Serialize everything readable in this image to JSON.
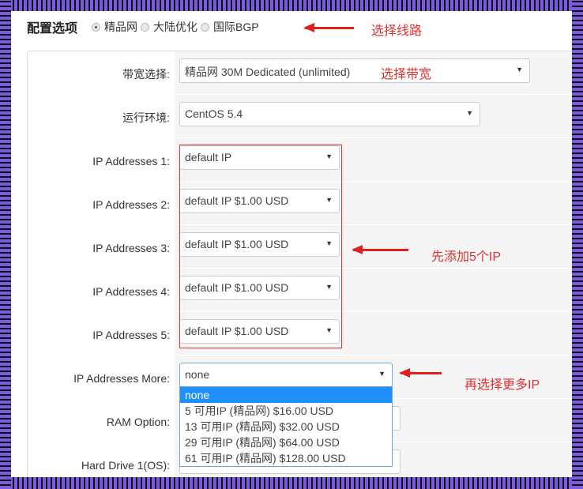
{
  "header": {
    "title": "配置选项",
    "line_options": [
      {
        "label": "精品网",
        "selected": true
      },
      {
        "label": "大陆优化",
        "selected": false
      },
      {
        "label": "国际BGP",
        "selected": false
      }
    ]
  },
  "annotations": {
    "choose_line": "选择线路",
    "choose_bandwidth": "选择带宽",
    "add_ips": "先添加5个IP",
    "more_ips": "再选择更多IP",
    "color": "#e03030"
  },
  "form": {
    "rows": [
      {
        "label": "带宽选择:",
        "value": "精品网 30M Dedicated (unlimited)"
      },
      {
        "label": "运行环境:",
        "value": "CentOS 5.4"
      },
      {
        "label": "IP Addresses 1:",
        "value": "default IP"
      },
      {
        "label": "IP Addresses 2:",
        "value": "default IP $1.00 USD"
      },
      {
        "label": "IP Addresses 3:",
        "value": "default IP $1.00 USD"
      },
      {
        "label": "IP Addresses 4:",
        "value": "default IP $1.00 USD"
      },
      {
        "label": "IP Addresses 5:",
        "value": "default IP $1.00 USD"
      },
      {
        "label": "IP Addresses More:",
        "value": "none"
      },
      {
        "label": "RAM Option:",
        "value": ""
      },
      {
        "label": "Hard Drive 1(OS):",
        "value": ""
      }
    ],
    "more_options": [
      "none",
      "5 可用IP (精品网) $16.00 USD",
      "13 可用IP (精品网) $32.00 USD",
      "29 可用IP (精品网) $64.00 USD",
      "61 可用IP (精品网) $128.00 USD"
    ]
  },
  "colors": {
    "frame": "#7b5be0",
    "highlight": "#1e90ff"
  }
}
